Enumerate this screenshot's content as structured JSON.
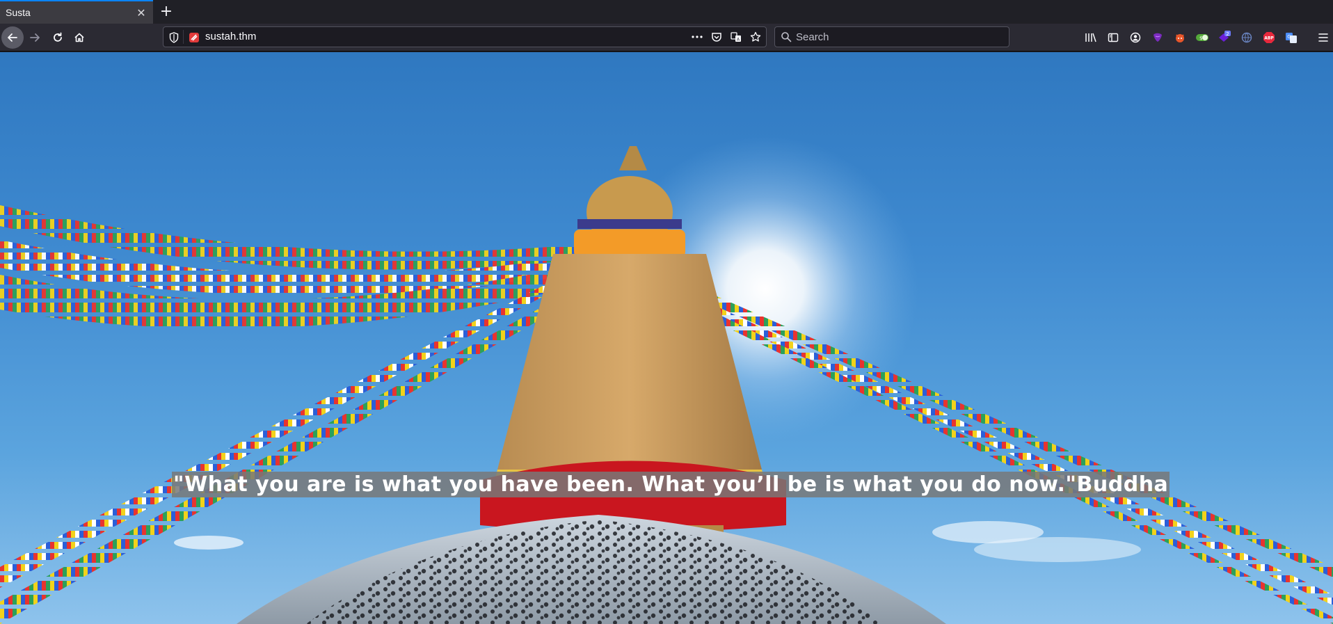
{
  "browser": {
    "tab": {
      "title": "Susta",
      "close_glyph": "✕"
    },
    "new_tab_glyph": "+",
    "toolbar": {
      "back_icon": "back-arrow-icon",
      "forward_icon": "forward-arrow-icon",
      "reload_icon": "reload-icon",
      "home_icon": "home-icon"
    },
    "urlbar": {
      "url": "sustah.thm",
      "actions": [
        "page-actions-icon",
        "pocket-icon",
        "translate-icon",
        "bookmark-star-icon"
      ]
    },
    "search": {
      "placeholder": "Search"
    },
    "extensions": {
      "icons": [
        "library-icon",
        "sidebar-icon",
        "account-icon",
        "extension-purple-icon",
        "extension-fox-icon",
        "extension-toggle-icon",
        "extension-badge-icon",
        "extension-globe-icon",
        "adblock-icon",
        "translate-ext-icon",
        "menu-icon"
      ],
      "badge_count": "2",
      "adblock_label": "ABP"
    }
  },
  "page": {
    "quote": "\"What you are is what you have been. What you’ll be is what you do now.\"Buddha"
  },
  "colors": {
    "accent": "#0a84ff",
    "toolbar_bg": "#2b2a33",
    "tab_bg": "#3c3b41",
    "sky": "#3f8ad0",
    "quote_bg": "#787878"
  }
}
